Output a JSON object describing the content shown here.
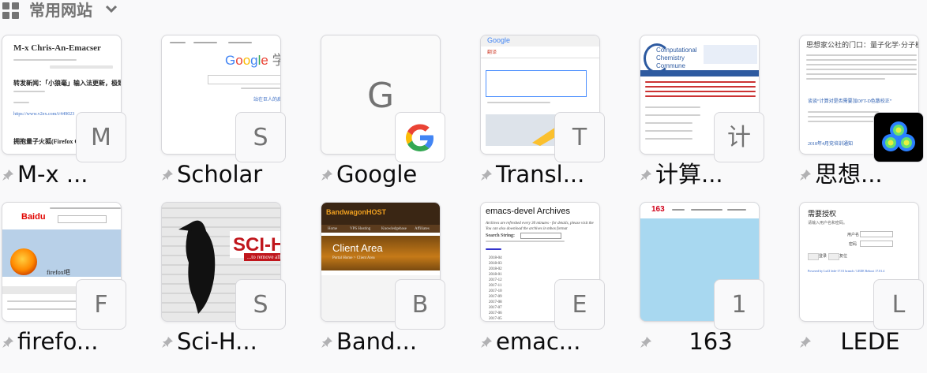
{
  "section": {
    "title": "常用网站"
  },
  "tiles": [
    {
      "label": "M-x ...",
      "letter": "M",
      "thumb": {
        "title": "M-x Chris-An-Emacser",
        "headline": "转发新闻：「小狼毫」输入法更新，极致0.11版",
        "link": "https://www.v2ex.com/t/449023",
        "post": "拥抱量子火狐(Firefox Quantum)"
      }
    },
    {
      "label": "Scholar",
      "letter": "S",
      "thumb": {
        "logo": "Google 学术",
        "link": "站在巨人的肩膀上"
      }
    },
    {
      "label": "Google",
      "letter": "G"
    },
    {
      "label": "Transl...",
      "letter": "T",
      "thumb": {
        "logo": "Google",
        "tab": "翻译"
      }
    },
    {
      "label": "计算...",
      "letter": "计",
      "thumb": {
        "title": "Computational Chemistry Commune"
      }
    },
    {
      "label": "思想...",
      "letter": "",
      "thumb": {
        "title": "思想家公社的门口：量子化学·分子模拟",
        "link": "谈谈“计算对是否需要加DFT-D色散校正”",
        "date": "2018年4月兖培训通知"
      }
    },
    {
      "label": "firefo...",
      "letter": "F",
      "thumb": {
        "logo": "Baidu",
        "name": "firefox吧"
      }
    },
    {
      "label": "Sci-H...",
      "letter": "S",
      "thumb": {
        "title": "SCI-H",
        "sub": "...to remove all"
      }
    },
    {
      "label": "Band...",
      "letter": "B",
      "thumb": {
        "logo": "BandwagonHOST",
        "nav": [
          "Home",
          "VPS Hosting",
          "Knowledgebase",
          "Affiliates"
        ],
        "area": "Client Area",
        "crumb": "Portal Home > Client Area"
      }
    },
    {
      "label": "emac...",
      "letter": "E",
      "thumb": {
        "title": "emacs-devel Archives",
        "intro": "Archives are refreshed every 30 minutes - for details, please visit the",
        "intro2": "You can also download the archives in mbox format",
        "search": "Search String:",
        "months": [
          "2018-04",
          "2018-03",
          "2018-02",
          "2018-01",
          "2017-12",
          "2017-11",
          "2017-10",
          "2017-09",
          "2017-08",
          "2017-07",
          "2017-06",
          "2017-05"
        ]
      }
    },
    {
      "label": "163",
      "letter": "1",
      "thumb": {
        "logo": "163"
      }
    },
    {
      "label": "LEDE",
      "letter": "L",
      "thumb": {
        "title": "需要授权",
        "sub": "请输入用户名和密码。",
        "user": "用户名",
        "pass": "密码",
        "btn1": "登录",
        "btn2": "复位",
        "footer": "Powered by LuCI lede-17.01 branch / LEDE Reboot 17.01.4"
      }
    }
  ],
  "colors": {
    "background": "#f9f9fa",
    "border": "#d7d7db",
    "muted": "#737373"
  }
}
